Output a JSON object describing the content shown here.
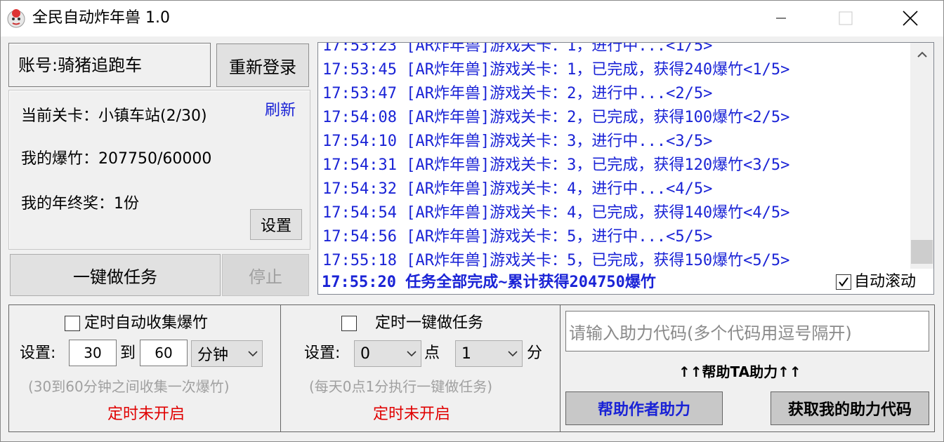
{
  "window": {
    "title": "全民自动炸年兽 1.0",
    "controls": {
      "minimize": "minimize-icon",
      "maximize": "maximize-icon",
      "close": "close-icon"
    }
  },
  "account": {
    "label": "账号:骑猪追跑车",
    "relogin_button": "重新登录"
  },
  "info": {
    "level": "当前关卡：小镇车站(2/30)",
    "firecrackers": "我的爆竹：207750/60000",
    "bonus": "我的年终奖：1份",
    "refresh_link": "刷新",
    "settings_button": "设置"
  },
  "actions": {
    "onekey_button": "一键做任务",
    "stop_button": "停止"
  },
  "log": {
    "lines": [
      "17:53:23 [AR炸年兽]游戏关卡：1，进行中...<1/5>",
      "17:53:45 [AR炸年兽]游戏关卡：1，已完成，获得240爆竹<1/5>",
      "17:53:47 [AR炸年兽]游戏关卡：2，进行中...<2/5>",
      "17:54:08 [AR炸年兽]游戏关卡：2，已完成，获得100爆竹<2/5>",
      "17:54:10 [AR炸年兽]游戏关卡：3，进行中...<3/5>",
      "17:54:31 [AR炸年兽]游戏关卡：3，已完成，获得120爆竹<3/5>",
      "17:54:32 [AR炸年兽]游戏关卡：4，进行中...<4/5>",
      "17:54:54 [AR炸年兽]游戏关卡：4，已完成，获得140爆竹<4/5>",
      "17:54:56 [AR炸年兽]游戏关卡：5，进行中...<5/5>",
      "17:55:18 [AR炸年兽]游戏关卡：5，已完成，获得150爆竹<5/5>"
    ],
    "final_line": "17:55:20 任务全部完成~累计获得204750爆竹",
    "autoscroll_label": "自动滚动",
    "autoscroll_checked": true,
    "text_color": "#1a23d6"
  },
  "timer_collect": {
    "checkbox_label": "定时自动收集爆竹",
    "settings_label": "设置:",
    "from_value": "30",
    "to_label": "到",
    "to_value": "60",
    "unit_select": "分钟",
    "hint": "(30到60分钟之间收集一次爆竹)",
    "status": "定时未开启"
  },
  "timer_task": {
    "checkbox_label": "定时一键做任务",
    "settings_label": "设置:",
    "hour_value": "0",
    "hour_label": "点",
    "minute_value": "1",
    "minute_label": "分",
    "hint": "(每天0点1分执行一键做任务)",
    "status": "定时未开启"
  },
  "help": {
    "code_placeholder": "请输入助力代码(多个代码用逗号隔开)",
    "help_ta_label": "↑↑帮助TA助力↑↑",
    "help_author_button": "帮助作者助力",
    "get_code_button": "获取我的助力代码"
  },
  "colors": {
    "accent_blue": "#1a23d6",
    "status_red": "#e00000",
    "disabled_gray": "#a0a0a0"
  }
}
